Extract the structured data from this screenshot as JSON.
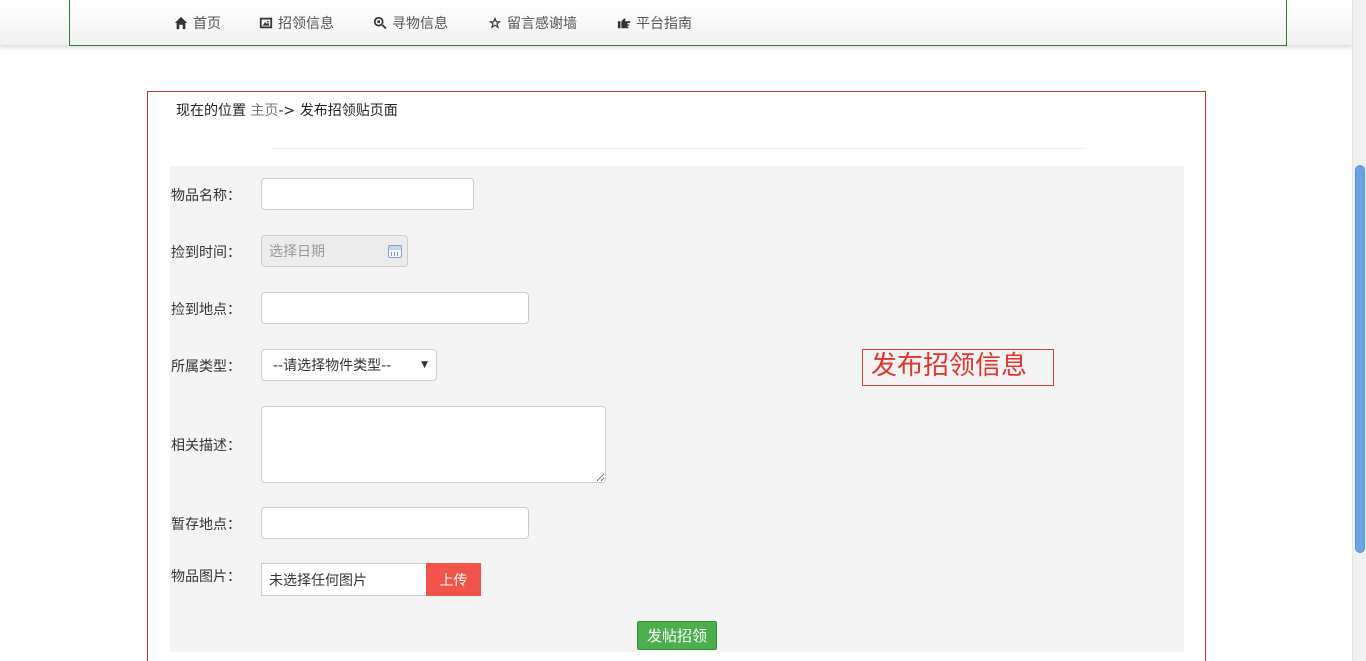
{
  "nav": {
    "items": [
      {
        "label": "首页",
        "icon": "home-icon"
      },
      {
        "label": "招领信息",
        "icon": "picture-icon"
      },
      {
        "label": "寻物信息",
        "icon": "search-icon"
      },
      {
        "label": "留言感谢墙",
        "icon": "star-icon"
      },
      {
        "label": "平台指南",
        "icon": "hand-right-icon"
      }
    ]
  },
  "breadcrumb": {
    "prefix": "现在的位置",
    "home": "主页",
    "separator": "->",
    "current": "发布招领贴页面"
  },
  "form": {
    "item_name_label": "物品名称：",
    "item_name_value": "",
    "found_time_label": "捡到时间：",
    "found_time_placeholder": "选择日期",
    "found_place_label": "捡到地点：",
    "found_place_value": "",
    "category_label": "所属类型：",
    "category_selected": "--请选择物件类型--",
    "description_label": "相关描述：",
    "description_value": "",
    "storage_label": "暂存地点：",
    "storage_value": "",
    "image_label": "物品图片：",
    "image_status": "未选择任何图片",
    "upload_label": "上传",
    "submit_label": "发帖招领"
  },
  "side_title": "发布招领信息",
  "colors": {
    "frame_border": "#c9302c",
    "upload_button": "#f0544a",
    "submit_button": "#4cae4c",
    "side_title": "#e0342c",
    "navbar_border": "#2e7d2e"
  }
}
